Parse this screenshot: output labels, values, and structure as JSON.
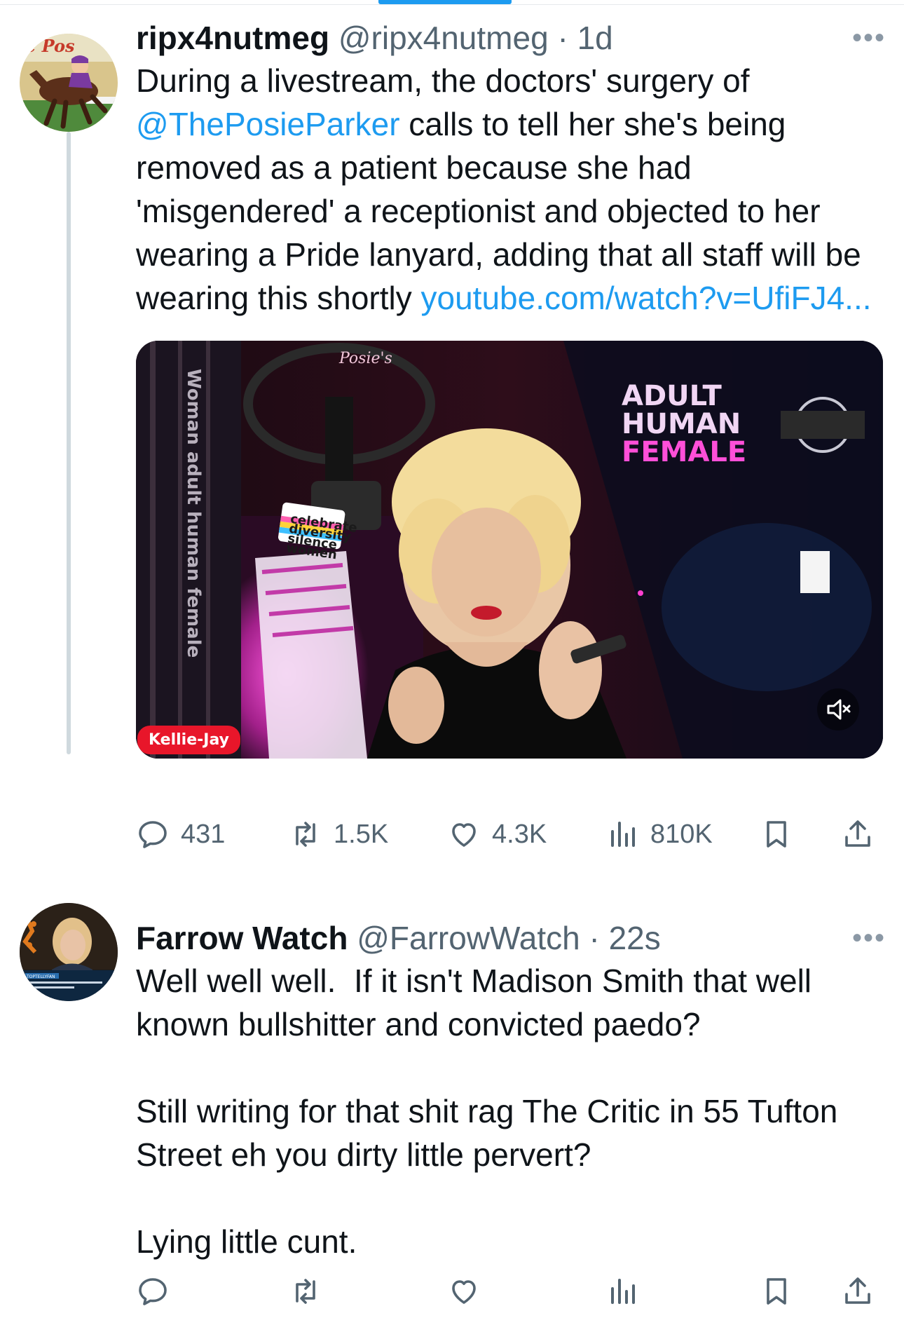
{
  "tweets": [
    {
      "display_name": "ripx4nutmeg",
      "handle": "@ripx4nutmeg",
      "separator": "·",
      "time": "1d",
      "more_label": "•••",
      "text_before": "During a livestream, the doctors' surgery of ",
      "mention": "@ThePosieParker",
      "text_middle": " calls to tell her she's being removed as a patient because she had 'misgendered' a receptionist and objected to her wearing a Pride lanyard, adding that all staff will be wearing this shortly ",
      "link": "youtube.com/watch?v=UfiFJ4...",
      "media": {
        "source_badge": "Kellie-Jay",
        "sign_lines": [
          "ADULT",
          "HUMAN",
          "FEMALE"
        ],
        "stand_label": "Posie's",
        "banner_text": "Woman adult human female",
        "lanyard_lines": [
          "celebrate",
          "diversity",
          "silence",
          "women"
        ]
      },
      "stats": {
        "replies": "431",
        "retweets": "1.5K",
        "likes": "4.3K",
        "views": "810K"
      }
    },
    {
      "display_name": "Farrow Watch",
      "handle": "@FarrowWatch",
      "separator": "·",
      "time": "22s",
      "more_label": "•••",
      "text": "Well well well.  If it isn't Madison Smith that well known bullshitter and convicted paedo?\n\nStill writing for that shit rag The Critic in 55 Tufton Street eh you dirty little pervert?\n\nLying little cunt.",
      "stats": {
        "replies": "",
        "retweets": "",
        "likes": "",
        "views": ""
      }
    }
  ],
  "colors": {
    "link": "#1d9bf0",
    "secondary": "#536471",
    "badge": "#e8162a",
    "neon_pink": "#ff3fd0"
  },
  "icons": [
    "reply-icon",
    "retweet-icon",
    "like-icon",
    "views-icon",
    "bookmark-icon",
    "share-icon",
    "mute-icon",
    "more-icon"
  ]
}
